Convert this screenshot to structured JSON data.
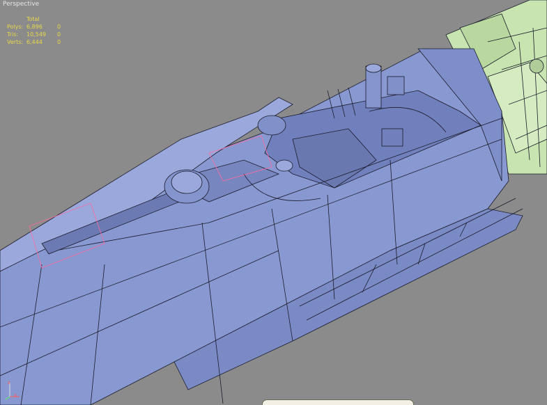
{
  "viewport": {
    "label": "Perspective",
    "background": "#8b8b8b"
  },
  "stats": {
    "header": "Total",
    "rows": [
      {
        "label": "Polys:",
        "total": "6,896",
        "selected": "0"
      },
      {
        "label": "Tris:",
        "total": "10,549",
        "selected": "0"
      },
      {
        "label": "Verts:",
        "total": "6,444",
        "selected": "0"
      }
    ],
    "color": "#e8d84a"
  },
  "colors": {
    "hull_main": "#8898d0",
    "hull_light": "#9aa8dc",
    "hull_dark": "#6a78b0",
    "wire": "#1a1a2a",
    "frozen_part": "#c8e4b0",
    "selection": "#ff6aa0"
  },
  "gizmo": {
    "axis_z": "z",
    "axis_x": "x",
    "icon": "axis-gizmo-icon"
  }
}
